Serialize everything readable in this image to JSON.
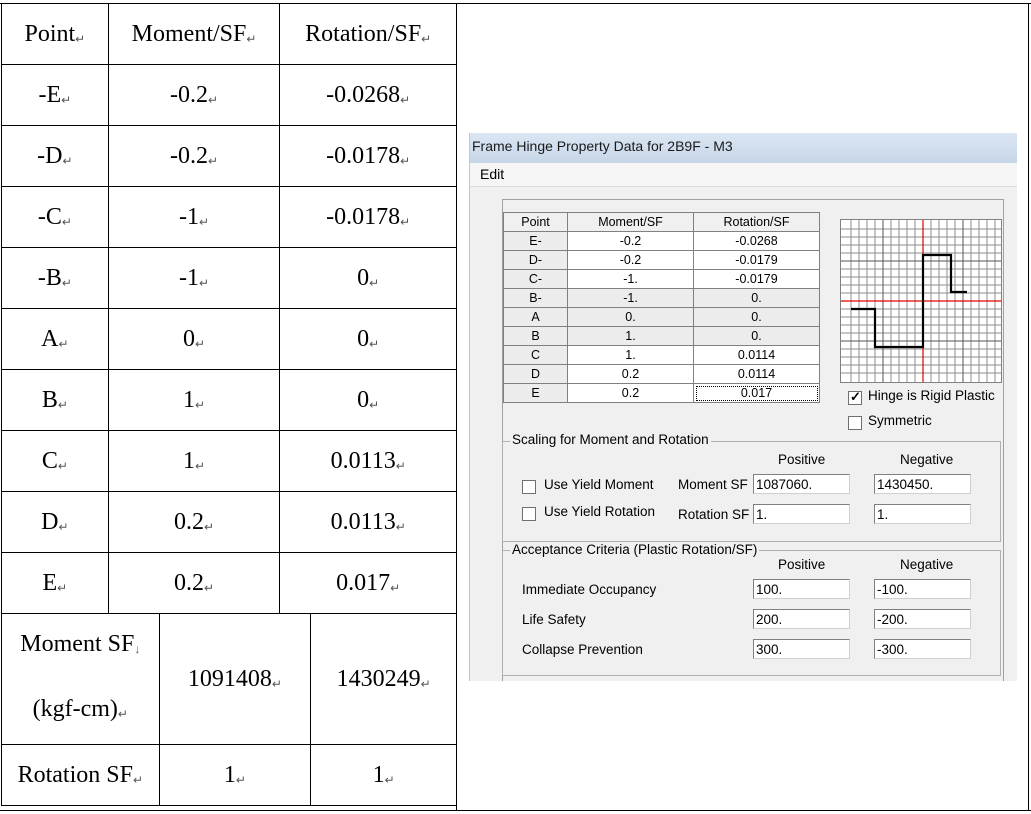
{
  "doc_table": {
    "headers": [
      "Point",
      "Moment/SF",
      "Rotation/SF"
    ],
    "rows": [
      [
        "-E",
        "-0.2",
        "-0.0268"
      ],
      [
        "-D",
        "-0.2",
        "-0.0178"
      ],
      [
        "-C",
        "-1",
        "-0.0178"
      ],
      [
        "-B",
        "-1",
        "0"
      ],
      [
        "A",
        "0",
        "0"
      ],
      [
        "B",
        "1",
        "0"
      ],
      [
        "C",
        "1",
        "0.0113"
      ],
      [
        "D",
        "0.2",
        "0.0113"
      ],
      [
        "E",
        "0.2",
        "0.017"
      ]
    ],
    "moment_sf_label_1": "Moment SF",
    "moment_sf_label_2": "(kgf-cm)",
    "moment_sf_pos": "1091408",
    "moment_sf_neg": "1430249",
    "rotation_sf_label": "Rotation SF",
    "rotation_sf_pos": "1",
    "rotation_sf_neg": "1"
  },
  "dialog": {
    "title": "Frame Hinge Property Data for 2B9F - M3",
    "menu_edit": "Edit",
    "table_headers": [
      "Point",
      "Moment/SF",
      "Rotation/SF"
    ],
    "table_rows": [
      [
        "E-",
        "-0.2",
        "-0.0268"
      ],
      [
        "D-",
        "-0.2",
        "-0.0179"
      ],
      [
        "C-",
        "-1.",
        "-0.0179"
      ],
      [
        "B-",
        "-1.",
        "0."
      ],
      [
        "A",
        "0.",
        "0."
      ],
      [
        "B",
        "1.",
        "0."
      ],
      [
        "C",
        "1.",
        "0.0114"
      ],
      [
        "D",
        "0.2",
        "0.0114"
      ],
      [
        "E",
        "0.2",
        "0.017"
      ]
    ],
    "rigid_plastic_label": "Hinge is Rigid Plastic",
    "rigid_plastic_checked": true,
    "symmetric_label": "Symmetric",
    "symmetric_checked": false,
    "scaling": {
      "title": "Scaling for Moment and Rotation",
      "positive": "Positive",
      "negative": "Negative",
      "use_yield_moment": "Use Yield Moment",
      "use_yield_rotation": "Use Yield Rotation",
      "moment_sf_label": "Moment SF",
      "rotation_sf_label": "Rotation SF",
      "moment_sf_pos": "1087060.",
      "moment_sf_neg": "1430450.",
      "rotation_sf_pos": "1.",
      "rotation_sf_neg": "1."
    },
    "acceptance": {
      "title": "Acceptance Criteria (Plastic Rotation/SF)",
      "positive": "Positive",
      "negative": "Negative",
      "io_label": "Immediate Occupancy",
      "ls_label": "Life Safety",
      "cp_label": "Collapse Prevention",
      "io_pos": "100.",
      "io_neg": "-100.",
      "ls_pos": "200.",
      "ls_neg": "-200.",
      "cp_pos": "300.",
      "cp_neg": "-300."
    },
    "colors": {
      "curve": "#000000",
      "axis": "#e00000",
      "grid": "#7f7f7f"
    }
  }
}
